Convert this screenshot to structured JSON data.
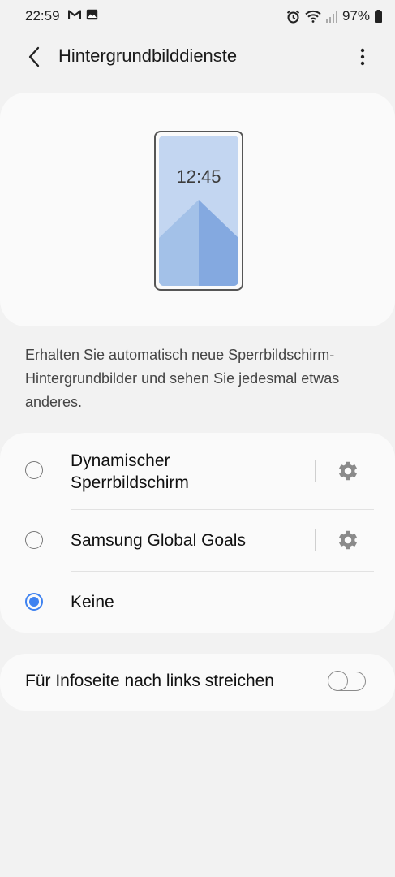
{
  "status_bar": {
    "time": "22:59",
    "battery": "97%",
    "left_icons": [
      "gmail-icon",
      "gallery-icon"
    ],
    "right_icons": [
      "alarm-icon",
      "wifi-icon",
      "signal-icon",
      "battery-icon"
    ]
  },
  "app_bar": {
    "title": "Hintergrundbilddienste",
    "back_icon": "back-arrow-icon",
    "more_icon": "more-vert-icon"
  },
  "preview": {
    "clock": "12:45"
  },
  "description": "Erhalten Sie automatisch neue Sperrbildschirm-Hintergrundbilder und sehen Sie jedesmal etwas anderes.",
  "options": [
    {
      "line1": "Dynamischer",
      "line2": "Sperrbildschirm",
      "selected": false,
      "has_settings": true
    },
    {
      "label": "Samsung Global Goals",
      "selected": false,
      "has_settings": true
    },
    {
      "label": "Keine",
      "selected": true,
      "has_settings": false
    }
  ],
  "swipe_setting": {
    "label": "Für Infoseite nach links streichen",
    "enabled": false
  },
  "colors": {
    "accent": "#3e82f0",
    "background": "#f2f2f2",
    "card": "#fafafa"
  }
}
